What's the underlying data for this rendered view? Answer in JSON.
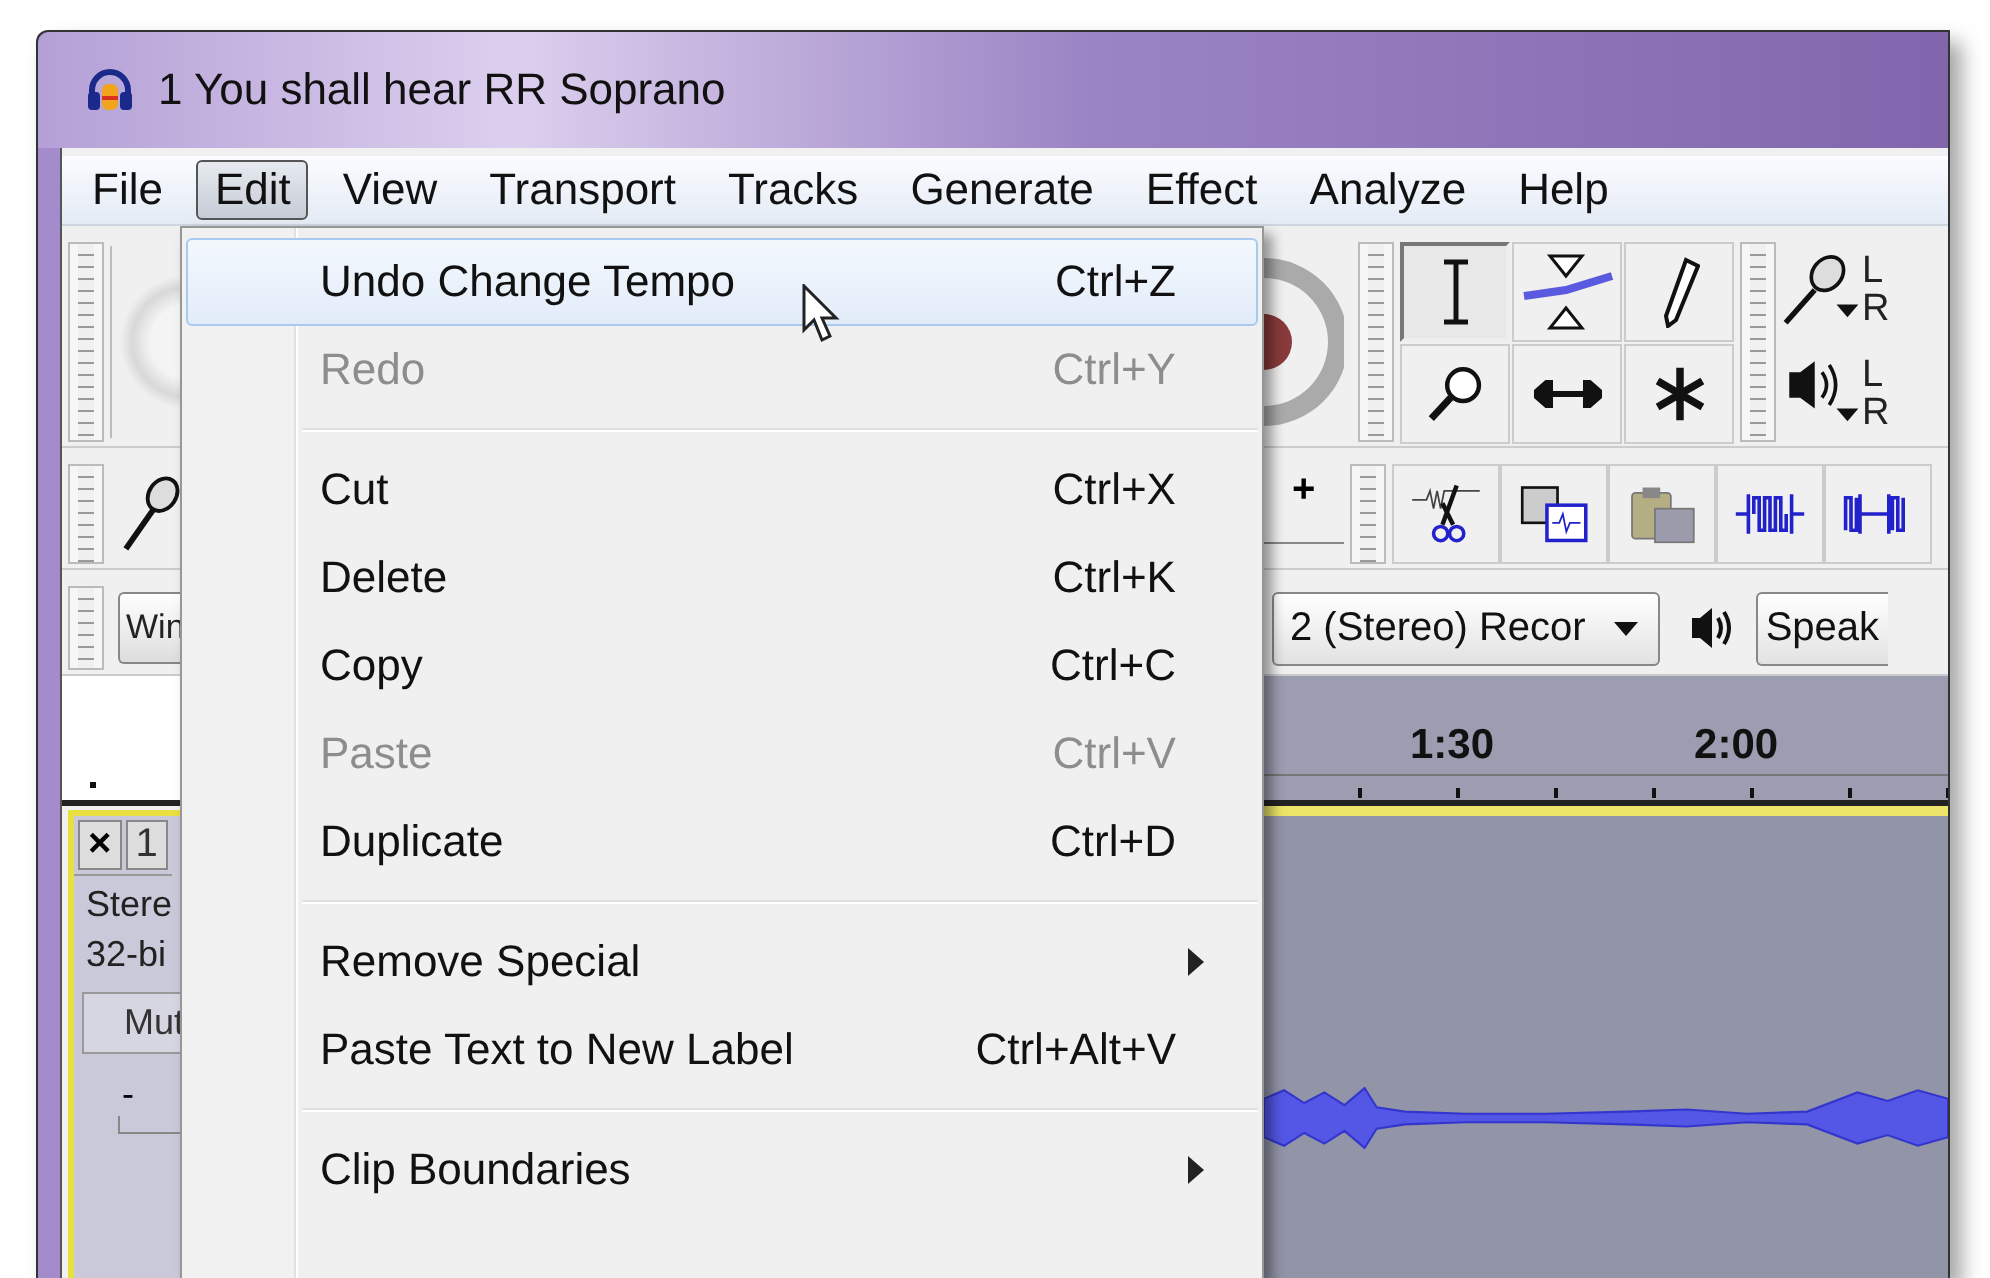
{
  "window": {
    "title": "1 You shall hear RR Soprano"
  },
  "menu_bar": [
    {
      "label": "File",
      "selected": false
    },
    {
      "label": "Edit",
      "selected": true
    },
    {
      "label": "View",
      "selected": false
    },
    {
      "label": "Transport",
      "selected": false
    },
    {
      "label": "Tracks",
      "selected": false
    },
    {
      "label": "Generate",
      "selected": false
    },
    {
      "label": "Effect",
      "selected": false
    },
    {
      "label": "Analyze",
      "selected": false
    },
    {
      "label": "Help",
      "selected": false
    }
  ],
  "edit_menu": {
    "items": [
      {
        "kind": "command",
        "label": "Undo Change Tempo",
        "shortcut": "Ctrl+Z",
        "highlighted": true,
        "disabled": false
      },
      {
        "kind": "command",
        "label": "Redo",
        "shortcut": "Ctrl+Y",
        "highlighted": false,
        "disabled": true
      },
      {
        "kind": "separator"
      },
      {
        "kind": "command",
        "label": "Cut",
        "shortcut": "Ctrl+X",
        "highlighted": false,
        "disabled": false
      },
      {
        "kind": "command",
        "label": "Delete",
        "shortcut": "Ctrl+K",
        "highlighted": false,
        "disabled": false
      },
      {
        "kind": "command",
        "label": "Copy",
        "shortcut": "Ctrl+C",
        "highlighted": false,
        "disabled": false
      },
      {
        "kind": "command",
        "label": "Paste",
        "shortcut": "Ctrl+V",
        "highlighted": false,
        "disabled": true
      },
      {
        "kind": "command",
        "label": "Duplicate",
        "shortcut": "Ctrl+D",
        "highlighted": false,
        "disabled": false
      },
      {
        "kind": "separator"
      },
      {
        "kind": "submenu",
        "label": "Remove Special",
        "highlighted": false,
        "disabled": false
      },
      {
        "kind": "command",
        "label": "Paste Text to New Label",
        "shortcut": "Ctrl+Alt+V",
        "highlighted": false,
        "disabled": false
      },
      {
        "kind": "separator"
      },
      {
        "kind": "submenu",
        "label": "Clip Boundaries",
        "highlighted": false,
        "disabled": false
      }
    ]
  },
  "tools": [
    {
      "selected": true
    },
    {
      "selected": false
    },
    {
      "selected": false
    },
    {
      "selected": false
    },
    {
      "selected": false
    },
    {
      "selected": false
    }
  ],
  "meters": [
    {
      "kind": "record",
      "left": "L",
      "right": "R"
    },
    {
      "kind": "playback",
      "left": "L",
      "right": "R"
    }
  ],
  "mixer": {
    "plus": "+"
  },
  "device_toolbar": {
    "host": "Win",
    "recording_device": "2 (Stereo) Recor",
    "output_device": "Speak"
  },
  "ruler": {
    "labels": [
      "1:30",
      "2:00"
    ]
  },
  "track": {
    "close": "×",
    "name": "1",
    "info": [
      "Stere",
      "32-bi"
    ],
    "mute": "Mut",
    "gain_minus": "-"
  }
}
